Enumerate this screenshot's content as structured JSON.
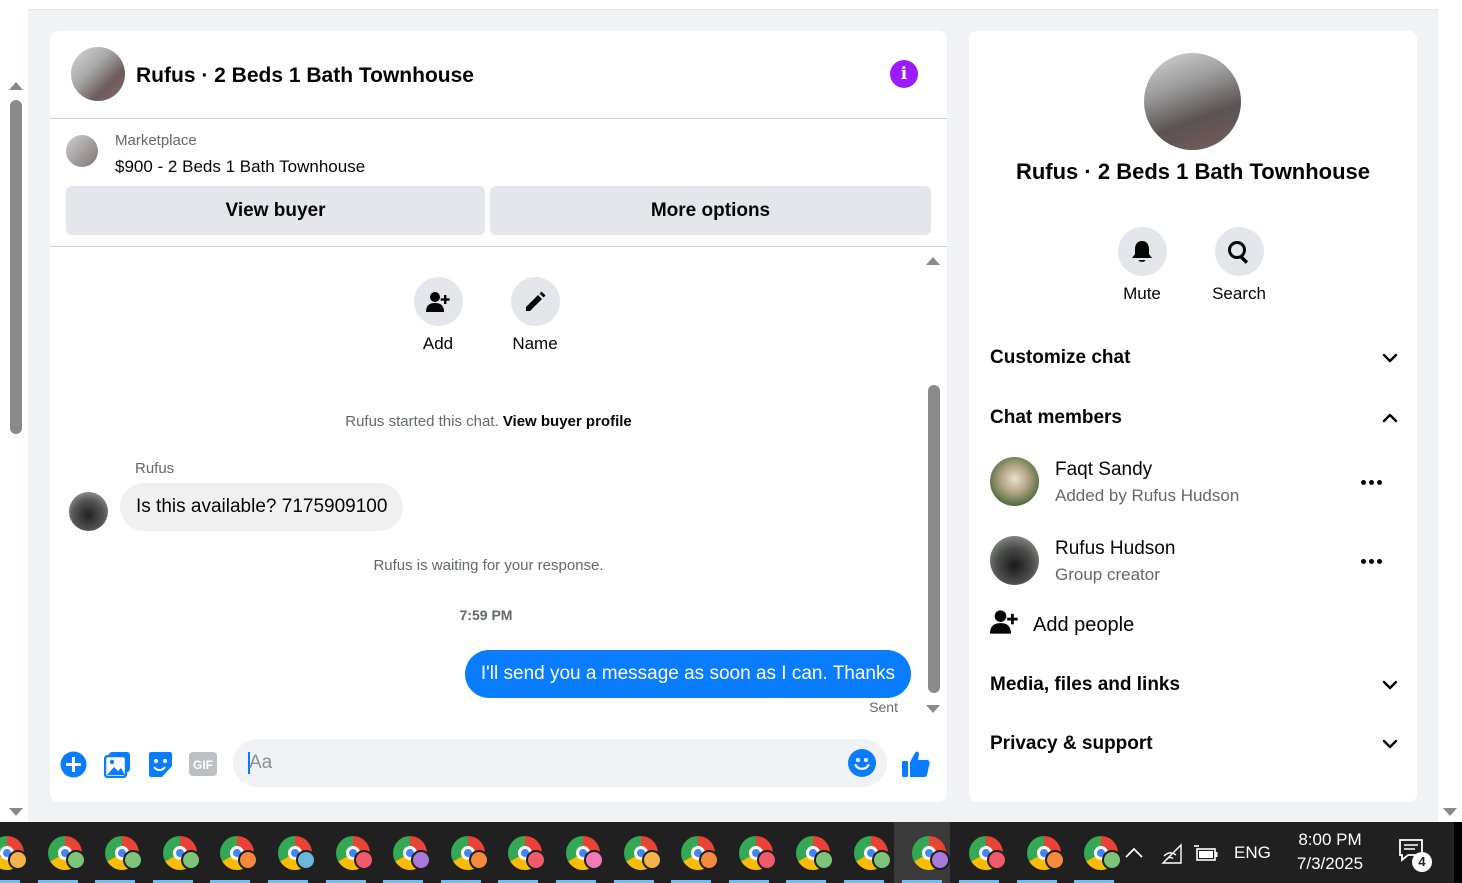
{
  "chat": {
    "title": "Rufus · 2 Beds 1 Bath Townhouse",
    "marketplace_label": "Marketplace",
    "listing": "$900 - 2 Beds 1 Bath Townhouse",
    "view_buyer": "View buyer",
    "more_options": "More options",
    "actions": {
      "add": "Add",
      "name": "Name"
    },
    "started_text": "Rufus started this chat.",
    "view_buyer_profile": "View buyer profile",
    "sender": "Rufus",
    "incoming_message": "Is this available? 7175909100",
    "waiting_text": "Rufus is waiting for your response.",
    "timestamp": "7:59 PM",
    "outgoing_message": "I'll send you a message as soon as I can. Thanks",
    "status": "Sent",
    "composer_placeholder": "Aa",
    "accent_color": "#0a7cff",
    "info_color": "#9c1aff"
  },
  "sidebar": {
    "name": "Rufus · 2 Beds 1 Bath Townhouse",
    "mute": "Mute",
    "search": "Search",
    "customize_chat": "Customize chat",
    "chat_members": "Chat members",
    "members": [
      {
        "name": "Faqt Sandy",
        "sub": "Added by Rufus Hudson"
      },
      {
        "name": "Rufus Hudson",
        "sub": "Group creator"
      }
    ],
    "add_people": "Add people",
    "media": "Media, files and links",
    "privacy": "Privacy & support"
  },
  "taskbar": {
    "apps_count": 19,
    "language": "ENG",
    "time": "8:00 PM",
    "date": "7/3/2025",
    "notifications": "4"
  }
}
